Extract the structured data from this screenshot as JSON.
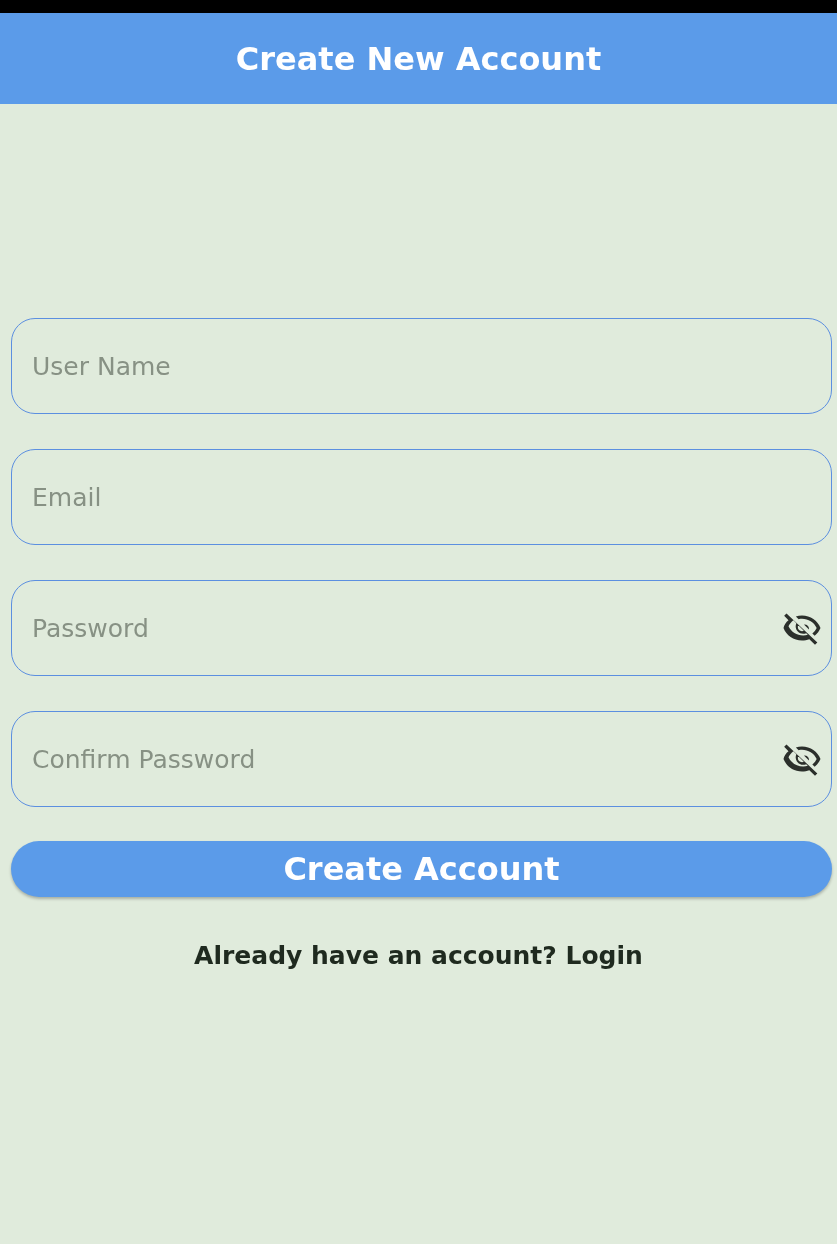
{
  "header": {
    "title": "Create New Account"
  },
  "fields": [
    {
      "kind": "text",
      "placeholder": "User Name"
    },
    {
      "kind": "text",
      "placeholder": "Email"
    },
    {
      "kind": "password",
      "placeholder": "Password"
    },
    {
      "kind": "password",
      "placeholder": "Confirm Password"
    }
  ],
  "submit_button": {
    "label": "Create Account"
  },
  "login_prompt": {
    "text": "Already have an account?",
    "link": "Login"
  }
}
